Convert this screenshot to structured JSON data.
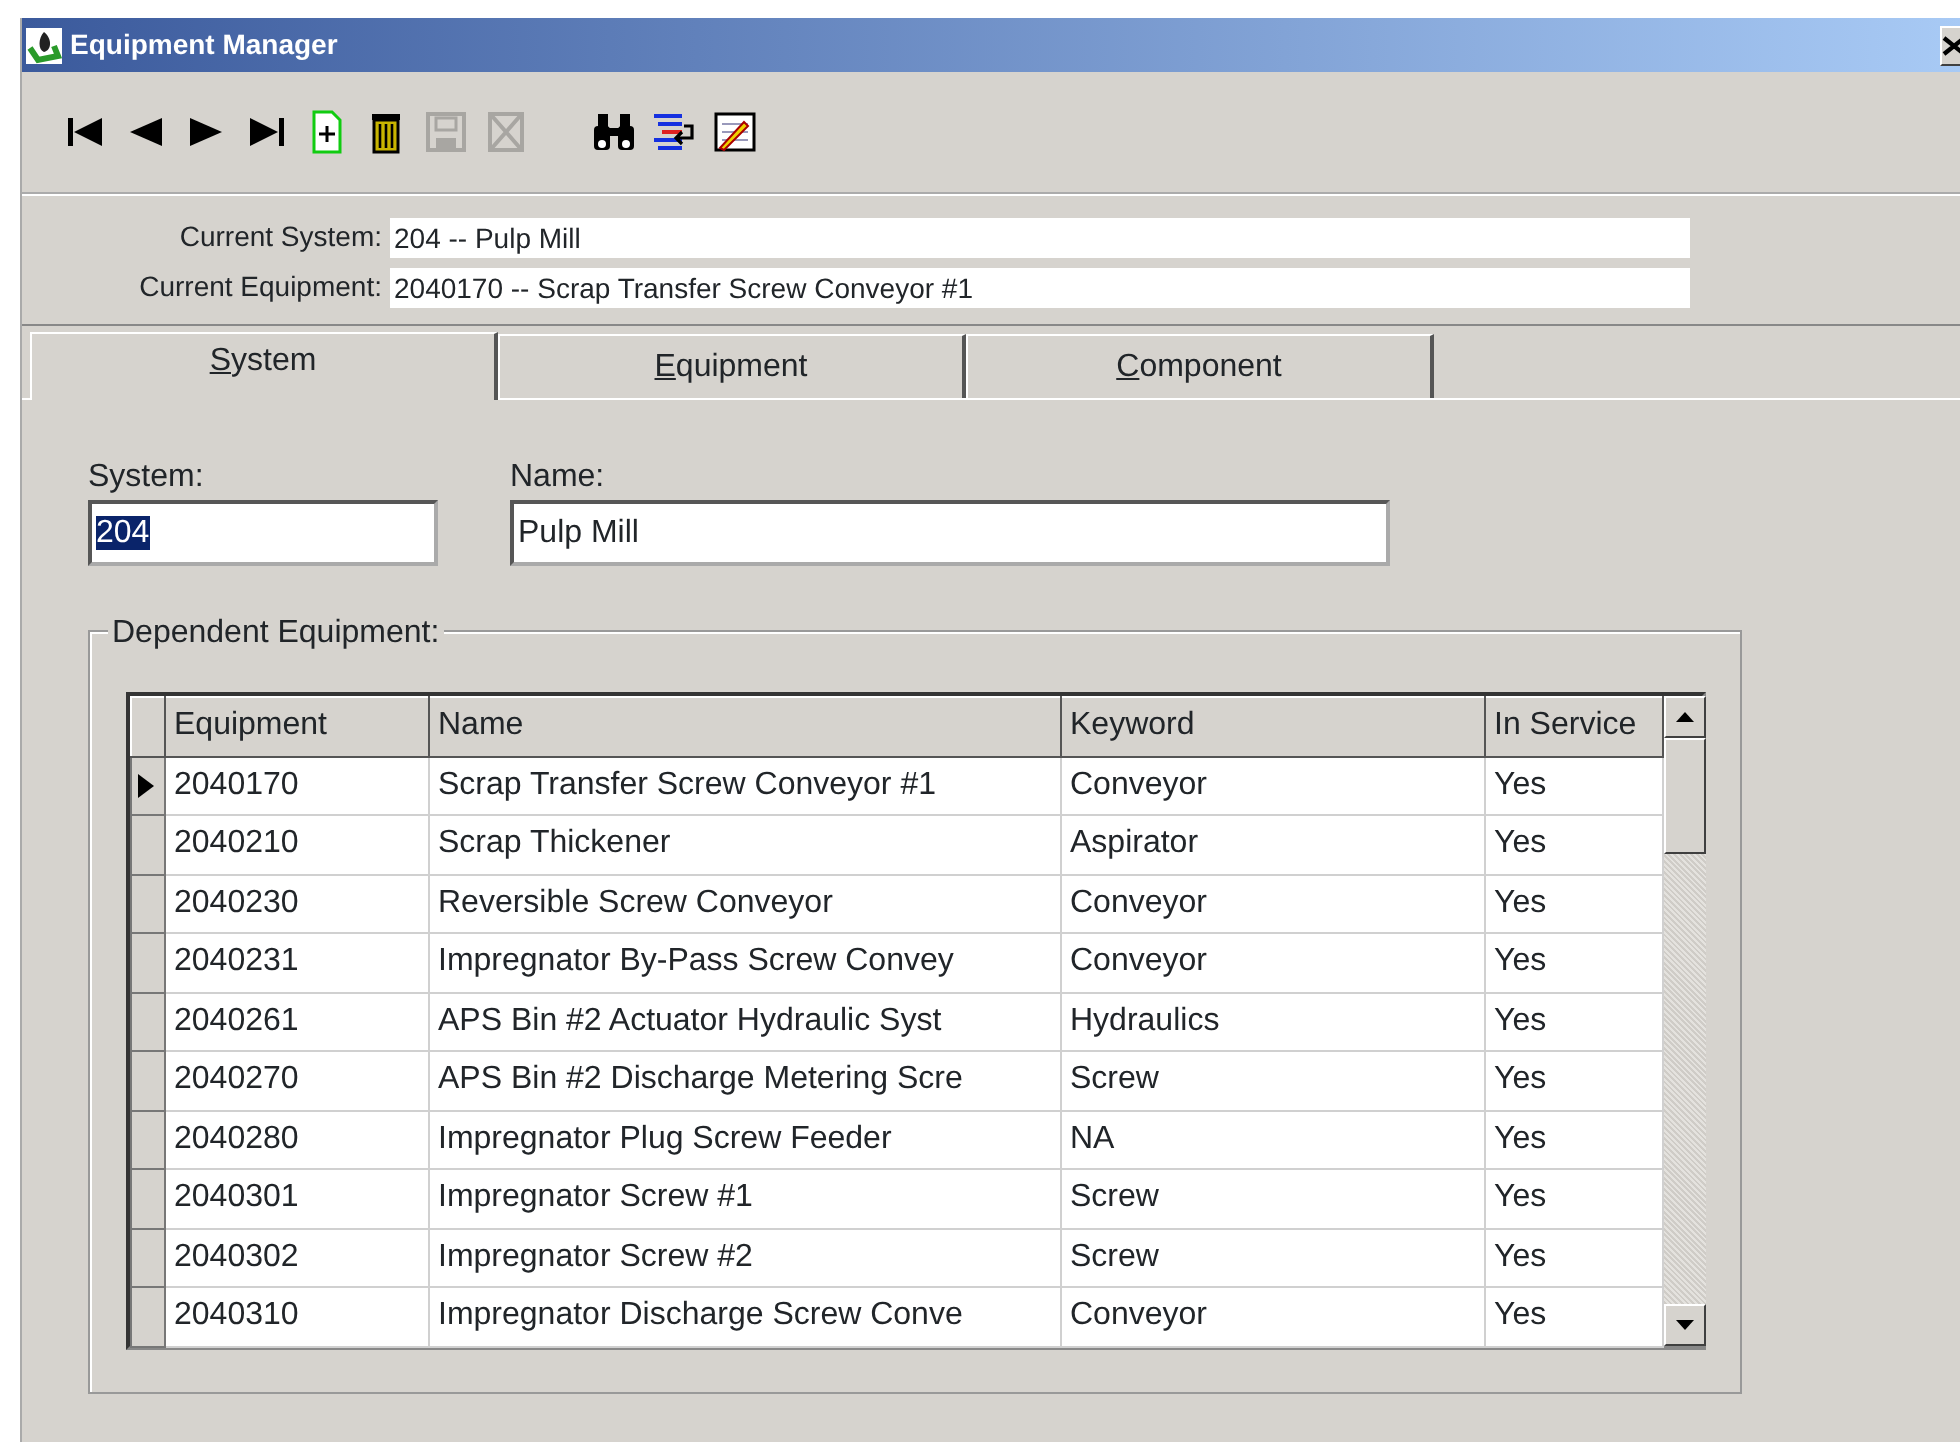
{
  "window": {
    "title": "Equipment Manager"
  },
  "toolbar": [
    {
      "kind": "first",
      "disabled": false
    },
    {
      "kind": "prev",
      "disabled": false
    },
    {
      "kind": "next",
      "disabled": false
    },
    {
      "kind": "last",
      "disabled": false
    },
    {
      "kind": "new",
      "disabled": false
    },
    {
      "kind": "delete",
      "disabled": false
    },
    {
      "kind": "save",
      "disabled": true
    },
    {
      "kind": "cancel",
      "disabled": true
    },
    {
      "kind": "find",
      "disabled": false
    },
    {
      "kind": "wrap",
      "disabled": false
    },
    {
      "kind": "note",
      "disabled": false
    }
  ],
  "current": [
    {
      "label": "Current System:",
      "value": "204 -- Pulp Mill"
    },
    {
      "label": "Current Equipment:",
      "value": "2040170 -- Scrap Transfer Screw Conveyor #1"
    }
  ],
  "tabs": [
    {
      "label": "System",
      "selected": true
    },
    {
      "label": "Equipment",
      "selected": false
    },
    {
      "label": "Component",
      "selected": false
    }
  ],
  "system_field": {
    "label": "System:",
    "value": "204",
    "text_selected": true
  },
  "name_field": {
    "label": "Name:",
    "value": "Pulp Mill"
  },
  "dependent_equipment": {
    "title": "Dependent Equipment:",
    "columns": [
      "Equipment",
      "Name",
      "Keyword",
      "In Service"
    ],
    "rows": [
      {
        "current": true,
        "cells": [
          "2040170",
          "Scrap Transfer Screw Conveyor #1",
          "Conveyor",
          "Yes"
        ]
      },
      {
        "current": false,
        "cells": [
          "2040210",
          "Scrap Thickener",
          "Aspirator",
          "Yes"
        ]
      },
      {
        "current": false,
        "cells": [
          "2040230",
          "Reversible Screw Conveyor",
          "Conveyor",
          "Yes"
        ]
      },
      {
        "current": false,
        "cells": [
          "2040231",
          "Impregnator By-Pass Screw Convey",
          "Conveyor",
          "Yes"
        ]
      },
      {
        "current": false,
        "cells": [
          "2040261",
          "APS Bin #2 Actuator Hydraulic Syst",
          "Hydraulics",
          "Yes"
        ]
      },
      {
        "current": false,
        "cells": [
          "2040270",
          "APS Bin #2 Discharge Metering Scre",
          "Screw",
          "Yes"
        ]
      },
      {
        "current": false,
        "cells": [
          "2040280",
          "Impregnator Plug Screw Feeder",
          "NA",
          "Yes"
        ]
      },
      {
        "current": false,
        "cells": [
          "2040301",
          "Impregnator Screw #1",
          "Screw",
          "Yes"
        ]
      },
      {
        "current": false,
        "cells": [
          "2040302",
          "Impregnator Screw #2",
          "Screw",
          "Yes"
        ]
      },
      {
        "current": false,
        "cells": [
          "2040310",
          "Impregnator Discharge Screw Conve",
          "Conveyor",
          "Yes"
        ]
      }
    ]
  }
}
